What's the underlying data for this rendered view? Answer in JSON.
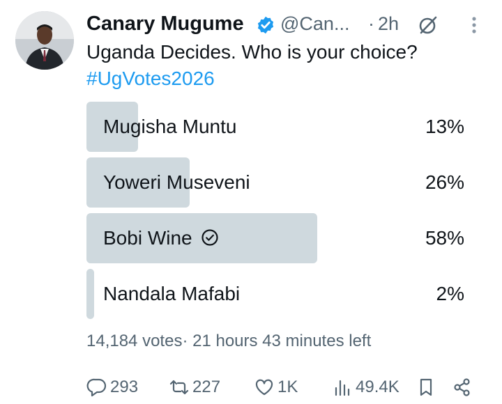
{
  "post": {
    "author_name": "Canary Mugume",
    "handle": "@Can...",
    "separator": "·",
    "time": "2h",
    "text": "Uganda Decides. Who is your choice?",
    "hashtag": "#UgVotes2026"
  },
  "poll": {
    "options": [
      {
        "label": "Mugisha Muntu",
        "percent_label": "13%",
        "percent": 13,
        "selected": false
      },
      {
        "label": "Yoweri Museveni",
        "percent_label": "26%",
        "percent": 26,
        "selected": false
      },
      {
        "label": "Bobi Wine",
        "percent_label": "58%",
        "percent": 58,
        "selected": true
      },
      {
        "label": "Nandala Mafabi",
        "percent_label": "2%",
        "percent": 2,
        "selected": false
      }
    ],
    "votes": "14,184 votes",
    "separator": "·",
    "time_left": "21 hours 43 minutes left"
  },
  "actions": {
    "replies": "293",
    "reposts": "227",
    "likes": "1K",
    "views": "49.4K"
  },
  "colors": {
    "accent": "#1d9bf0",
    "bar": "#cfd9de",
    "muted": "#536471",
    "text": "#0f1419"
  },
  "icons": [
    "verified-badge-icon",
    "grok-icon",
    "more-options-icon",
    "check-circle-icon",
    "reply-icon",
    "repost-icon",
    "like-icon",
    "views-icon",
    "bookmark-icon",
    "share-icon"
  ]
}
